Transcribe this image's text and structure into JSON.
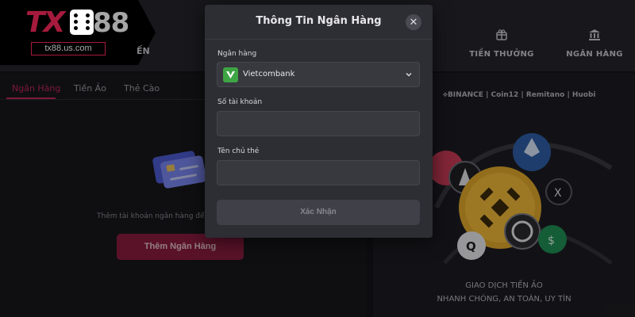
{
  "brand": {
    "logo_text": "TX88",
    "logo_tx": "TX",
    "logo_num": "88",
    "url": "tx88.us.com"
  },
  "header": {
    "partial_nav_label": "ẾN",
    "nav": [
      {
        "label": "TIỀN THƯỞNG",
        "icon": "gift-icon"
      },
      {
        "label": "NGÂN HÀNG",
        "icon": "bank-icon"
      }
    ]
  },
  "left_panel": {
    "tabs": [
      {
        "label": "Ngân Hàng",
        "active": true
      },
      {
        "label": "Tiền Ảo",
        "active": false
      },
      {
        "label": "Thẻ Cào",
        "active": false
      }
    ],
    "hint": "Thêm tài khoản ngân hàng để bắt đầ",
    "add_button": "Thêm Ngân Hàng",
    "illustration_icon": "bank-cards-icon"
  },
  "right_panel": {
    "exchanges": "⟡BINANCE | Coin12 | Remitano | Huobi",
    "promo_line1": "GIAO DỊCH TIỀN ẢO",
    "promo_line2": "NHANH CHÓNG, AN TOÀN, UY TÍN",
    "coins_icon": "crypto-coins-icon"
  },
  "modal": {
    "title": "Thông Tin Ngân Hàng",
    "close_icon": "close-icon",
    "bank_label": "Ngân hàng",
    "bank_selected": "Vietcombank",
    "bank_logo_icon": "vietcombank-logo-icon",
    "account_number_label": "Số tài khoản",
    "account_number_value": "",
    "holder_name_label": "Tên chủ thẻ",
    "holder_name_value": "",
    "confirm_button": "Xác Nhận"
  },
  "colors": {
    "accent": "#c02655",
    "brand_red": "#ff2a5f",
    "modal_bg": "#2d2d34",
    "page_bg": "#151519",
    "vietcombank_green": "#3ea545"
  }
}
